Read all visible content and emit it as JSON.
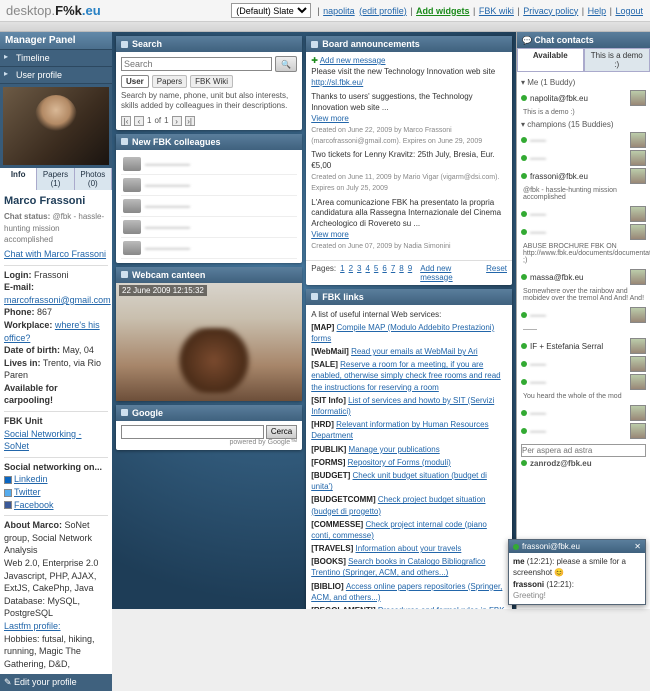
{
  "brand": {
    "part1": "desktop.",
    "part2": "F%k",
    "part3": ".eu"
  },
  "skin": {
    "label": "(Default) Slate"
  },
  "toplinks": {
    "user": "napolita",
    "edit_profile": "(edit profile)",
    "add_widgets": "Add widgets",
    "wiki": "FBK wiki",
    "privacy": "Privacy policy",
    "help": "Help",
    "logout": "Logout"
  },
  "left": {
    "panel_title": "Manager Panel",
    "items": [
      "Timeline",
      "User profile"
    ],
    "tabs": [
      "Info",
      "Papers (1)",
      "Photos (0)"
    ],
    "name": "Marco Frassoni",
    "status_label": "Chat status:",
    "status_text": "@fbk - hassle-hunting mission accomplished",
    "chat_with": "Chat with Marco Frassoni",
    "login_lbl": "Login:",
    "login": "Frassoni",
    "email_lbl": "E-mail:",
    "email": "marcofrassoni@gmail.com",
    "phone_lbl": "Phone:",
    "phone": "867",
    "workplace_lbl": "Workplace:",
    "workplace": "where's his office?",
    "dob_lbl": "Date of birth:",
    "dob": "May, 04",
    "lives_lbl": "Lives in:",
    "lives": "Trento, via Rio Paren",
    "carpool": "Available for carpooling!",
    "unit_lbl": "FBK Unit",
    "unit": "Social Networking - SoNet",
    "sn_title": "Social networking on...",
    "sn_items": [
      "Linkedin",
      "Twitter",
      "Facebook"
    ],
    "about_title": "About Marco:",
    "about": "SoNet group, Social Network Analysis",
    "skills1": "Web 2.0, Enterprise 2.0",
    "skills2": "Javascript, PHP, AJAX, ExtJS, CakePhp, Java",
    "skills3": "Database: MySQL, PostgreSQL",
    "lastfm": "Lastfm profile:",
    "hobbies": "Hobbies: futsal, hiking, running, Magic The Gathering, D&D,",
    "edit": "Edit your profile"
  },
  "search": {
    "title": "Search",
    "placeholder": "Search",
    "btn": "🔍",
    "tabs": [
      "User",
      "Papers",
      "FBK Wiki"
    ],
    "hint": "Search by name, phone, unit but also interests, skills added by colleagues in their descriptions.",
    "pg_of": "of",
    "pg_cur": "1",
    "pg_total": "1"
  },
  "colleagues": {
    "title": "New FBK colleagues",
    "items": [
      "—————",
      "—————",
      "—————",
      "—————",
      "—————"
    ]
  },
  "webcam": {
    "title": "Webcam canteen",
    "timestamp": "22 June 2009 12:15:32"
  },
  "google": {
    "title": "Google",
    "btn": "Cerca",
    "attr": "powered by Google™"
  },
  "board": {
    "title": "Board announcements",
    "add": "Add new message",
    "items": [
      {
        "text": "Please visit the new Technology Innovation web site",
        "link": "http://sl.fbk.eu/",
        "meta": "",
        "more": ""
      },
      {
        "text": "Thanks to users' suggestions, the Technology Innovation web site ...",
        "link": "",
        "meta": "Created on June 22, 2009 by Marco Frassoni (marcofrassoni@gmail.com). Expires on June 29, 2009",
        "more": "View more"
      },
      {
        "text": "Two tickets for Lenny Kravitz: 25th July, Bresia, Eur. €5,00",
        "link": "",
        "meta": "Created on June 11, 2009 by Mario Vigar (vigarm@dsi.com). Expires on July 25, 2009",
        "more": ""
      },
      {
        "text": "L'Area comunicazione FBK ha presentato la propria candidatura alla Rassegna Internazionale del Cinema Archeologico di Rovereto su ...",
        "link": "",
        "meta": "Created on June 07, 2009 by Nadia Simonini",
        "more": "View more"
      }
    ],
    "pager_label": "Pages:",
    "pages": [
      "1",
      "2",
      "3",
      "4",
      "5",
      "6",
      "7",
      "8",
      "9"
    ],
    "reset": "Reset"
  },
  "links": {
    "title": "FBK links",
    "intro": "A list of useful internal Web services:",
    "items": [
      {
        "tag": "[MAP]",
        "text": "Compile MAP (Modulo Addebito Prestazioni) forms"
      },
      {
        "tag": "[WebMail]",
        "text": "Read your emails at WebMail by Ari"
      },
      {
        "tag": "[SALE]",
        "text": "Reserve a room for a meeting, if you are enabled, otherwise simply check free rooms and read the instructions for reserving a room"
      },
      {
        "tag": "[SIT Info]",
        "text": "List of services and howto by SIT (Servizi Informatici)"
      },
      {
        "tag": "[HRD]",
        "text": "Relevant information by Human Resources Department"
      },
      {
        "tag": "[PUBLIK]",
        "text": "Manage your publications"
      },
      {
        "tag": "[FORMS]",
        "text": "Repository of Forms (moduli)"
      },
      {
        "tag": "[BUDGET]",
        "text": "Check unit budget situation (budget di unita')"
      },
      {
        "tag": "[BUDGETCOMM]",
        "text": "Check project budget situation (budget di progetto)"
      },
      {
        "tag": "[COMMESSE]",
        "text": "Check project internal code (piano conti, commesse)"
      },
      {
        "tag": "[TRAVELS]",
        "text": "Information about your travels"
      },
      {
        "tag": "[BOOKS]",
        "text": "Search books in Catalogo Bibliografico Trentino (Springer, ACM, and others...)"
      },
      {
        "tag": "[BIBLIO]",
        "text": "Access online papers repositories (Springer, ACM, and others...)"
      },
      {
        "tag": "[REGOLAMENTI]",
        "text": "Procedures and formal rules in FBK (in Italian)"
      }
    ]
  },
  "chat": {
    "title": "Chat contacts",
    "tabs": [
      "Available",
      "This is a demo :)"
    ],
    "groups": [
      {
        "name": "Me (1 Buddy)",
        "contacts": [
          {
            "name": "napolita@fbk.eu",
            "msg": "This is a demo :)"
          }
        ]
      },
      {
        "name": "champions (15 Buddies)",
        "contacts": [
          {
            "name": "——",
            "msg": ""
          },
          {
            "name": "——",
            "msg": ""
          },
          {
            "name": "frassoni@fbk.eu",
            "msg": "@fbk - hassle-hunting mission accomplished"
          },
          {
            "name": "——",
            "msg": ""
          },
          {
            "name": "——",
            "msg": "ABUSE BROCHURE FBK ON http://www.fbk.eu/documents/documentation ;)"
          },
          {
            "name": "massa@fbk.eu",
            "msg": "Somewhere over the rainbow and mobidev over the tremol And And! And!"
          },
          {
            "name": "——",
            "msg": "——"
          },
          {
            "name": "IF + Estefania Serral",
            "msg": ""
          },
          {
            "name": "——",
            "msg": ""
          },
          {
            "name": "——",
            "msg": "You heard the whole of the mod"
          },
          {
            "name": "——",
            "msg": ""
          },
          {
            "name": "——",
            "msg": ""
          }
        ]
      }
    ],
    "input_ph": "Per aspera ad astra",
    "self": "zanrodz@fbk.eu"
  },
  "chat_pop": {
    "peer": "frassoni@fbk.eu",
    "line1_author": "me",
    "line1_time": "(12:21):",
    "line1_text": "please a smile for a screenshot 😊",
    "line2_author": "frassoni",
    "line2_time": "(12:21):",
    "line2_text": "Greeting!",
    "close": "✕"
  }
}
